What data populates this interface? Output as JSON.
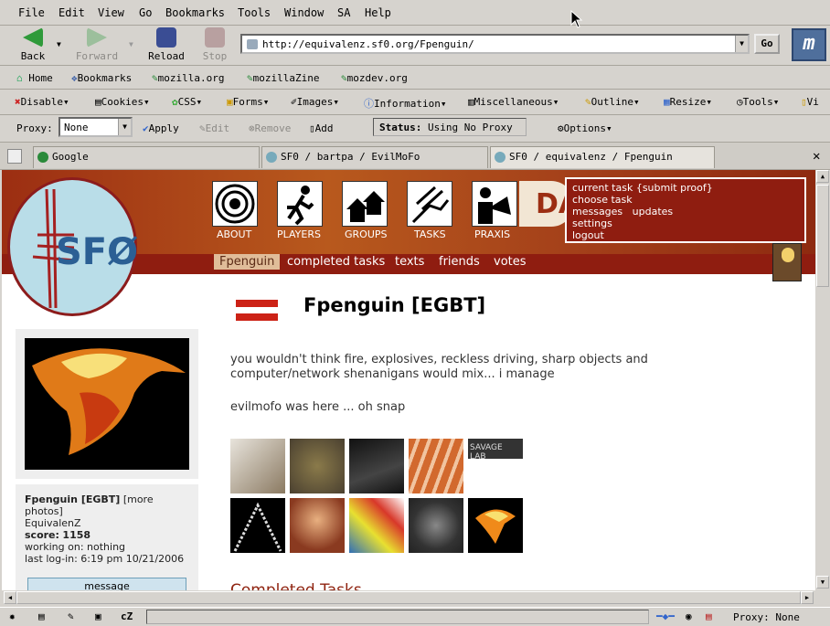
{
  "menu": [
    "File",
    "Edit",
    "View",
    "Go",
    "Bookmarks",
    "Tools",
    "Window",
    "SA",
    "Help"
  ],
  "nav": {
    "back": "Back",
    "forward": "Forward",
    "reload": "Reload",
    "stop": "Stop",
    "go": "Go"
  },
  "url": "http://equivalenz.sf0.org/Fpenguin/",
  "bookmarks": [
    "Home",
    "Bookmarks",
    "mozilla.org",
    "mozillaZine",
    "mozdev.org"
  ],
  "devbar": [
    "Disable",
    "Cookies",
    "CSS",
    "Forms",
    "Images",
    "Information",
    "Miscellaneous",
    "Outline",
    "Resize",
    "Tools",
    "Vi"
  ],
  "proxy": {
    "label": "Proxy:",
    "value": "None",
    "apply": "Apply",
    "edit": "Edit",
    "remove": "Remove",
    "add": "Add",
    "status_label": "Status:",
    "status_value": "Using No Proxy",
    "options": "Options"
  },
  "tabs": [
    "Google",
    "SF0 / bartpa / EvilMoFo",
    "SF0 / equivalenz / Fpenguin"
  ],
  "site": {
    "icons": [
      "ABOUT",
      "PLAYERS",
      "GROUPS",
      "TASKS",
      "PRAXIS"
    ],
    "popup": [
      "current task {submit proof}",
      "choose task",
      "messages",
      "updates",
      "settings",
      "logout"
    ],
    "subnav": [
      "Fpenguin",
      "completed tasks",
      "texts",
      "friends",
      "votes"
    ],
    "title": "Fpenguin [EGBT]",
    "bio": "you wouldn't think fire, explosives, reckless driving, sharp objects and computer/network shenanigans would mix... i manage",
    "ev": "evilmofo was here ... oh snap",
    "thumb_text": "SAVAGE LAB",
    "profile": {
      "name": "Fpenguin [EGBT]",
      "more": "[more photos]",
      "group": "EquivalenZ",
      "score_label": "score:",
      "score": "1158",
      "working": "working on: nothing",
      "login": "last log-in: 6:19 pm 10/21/2006",
      "message": "message"
    },
    "completed": "Completed Tasks"
  },
  "statusbar": {
    "proxy": "Proxy: None"
  }
}
